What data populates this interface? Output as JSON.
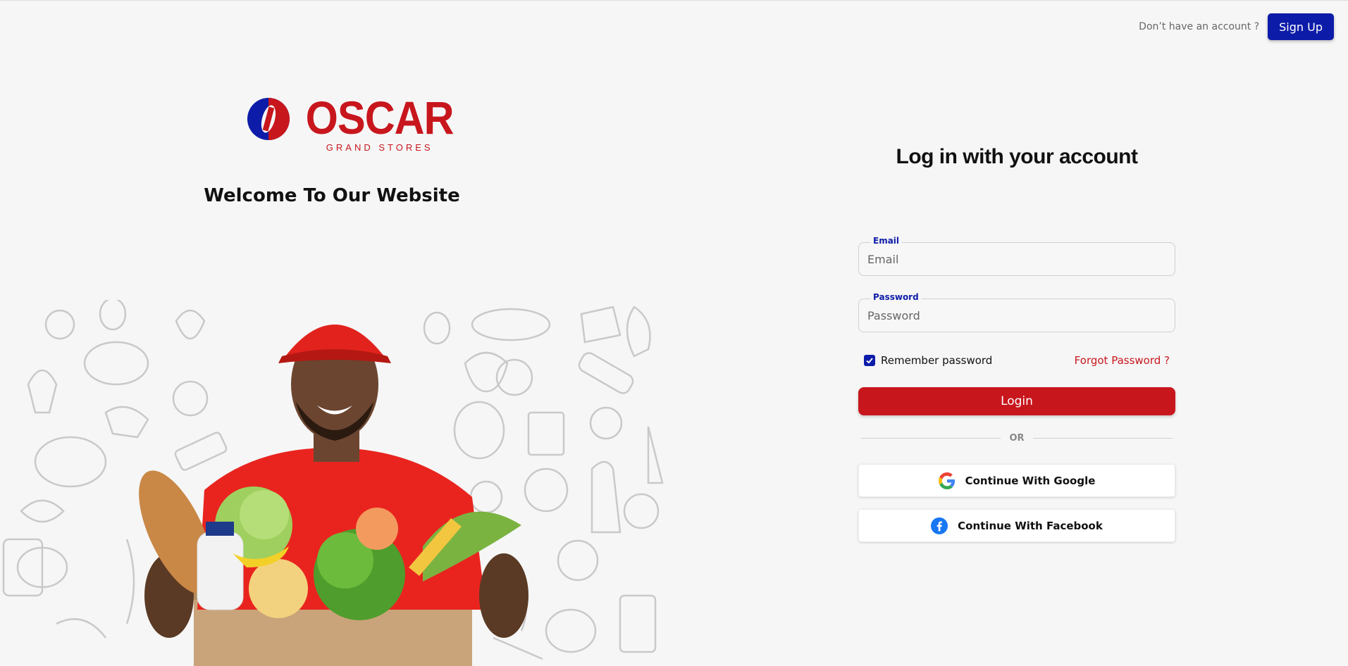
{
  "header": {
    "account_prompt": "Don’t have an account ?",
    "signup_label": "Sign Up"
  },
  "brand": {
    "name": "OSCAR",
    "tagline": "GRAND STORES",
    "welcome": "Welcome To Our Website",
    "colors": {
      "primary_red": "#c8161d",
      "primary_blue": "#0d1ca8"
    }
  },
  "illustration": {
    "description_icon": "delivery-person-with-grocery-box-image"
  },
  "login_form": {
    "title": "Log in with your account",
    "email": {
      "label": "Email",
      "placeholder": "Email",
      "value": ""
    },
    "password": {
      "label": "Password",
      "placeholder": "Password",
      "value": ""
    },
    "remember_label": "Remember password",
    "remember_checked": true,
    "forgot_label": "Forgot Password ?",
    "login_label": "Login",
    "divider_text": "OR",
    "google_label": "Continue With Google",
    "facebook_label": "Continue With Facebook"
  }
}
